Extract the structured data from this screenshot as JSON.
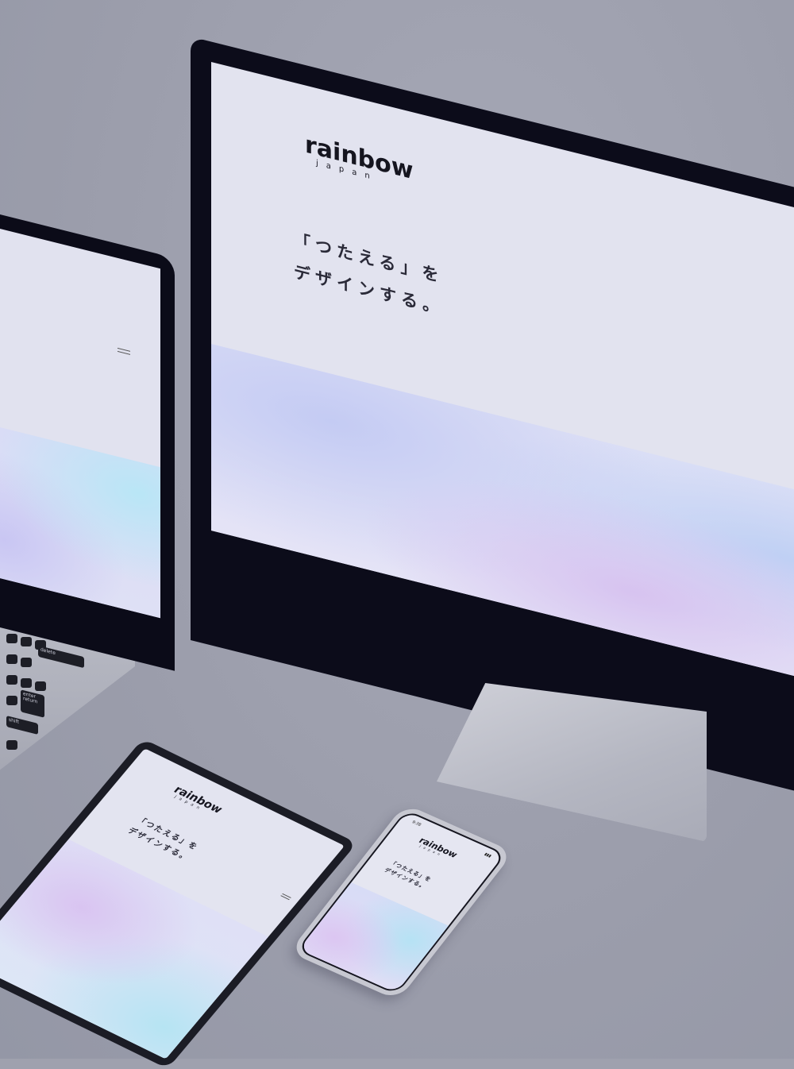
{
  "brand": {
    "name": "rainbow",
    "sub": "japan"
  },
  "hero": {
    "line1": "「つたえる」を",
    "line2": "デザインする。"
  },
  "phone": {
    "time": "9:38",
    "status": "▮▮▮"
  },
  "laptop_keys": {
    "delete": "delete",
    "enter": "enter",
    "return": "return",
    "shift": "shift"
  }
}
